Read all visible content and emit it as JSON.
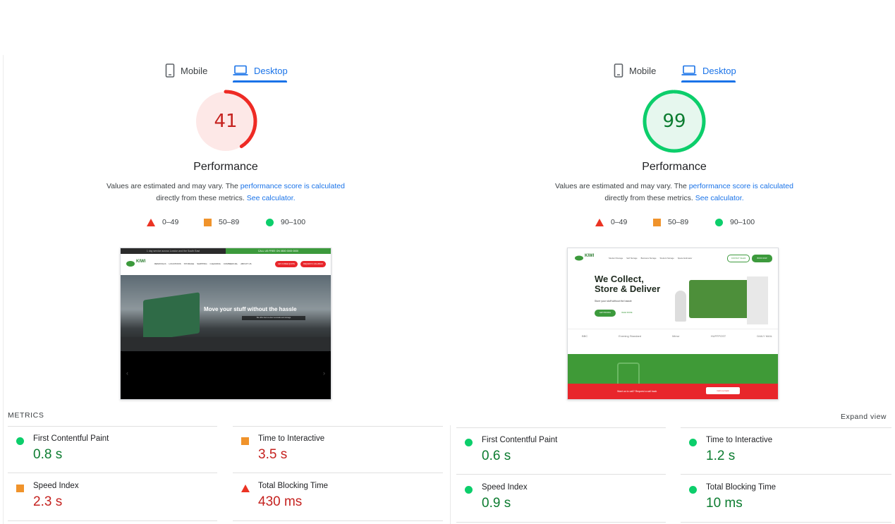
{
  "left": {
    "tabs": {
      "mobile": "Mobile",
      "desktop": "Desktop"
    },
    "score": "41",
    "score_fraction": 0.41,
    "score_color": "#ee2a24",
    "score_bg": "#fde8e7",
    "title": "Performance",
    "desc_prefix": "Values are estimated and may vary. The ",
    "desc_link1": "performance score is calculated",
    "desc_mid": " directly from these metrics. ",
    "desc_link2": "See calculator.",
    "legend": {
      "fail": "0–49",
      "average": "50–89",
      "pass": "90–100"
    },
    "thumbnail": {
      "topbar_left": "1 day service across London and the South East",
      "topbar_right": "CALL US FREE ON 0800 0000 0000",
      "logo": "KIWI",
      "nav": [
        "REMOVALS",
        "LOCATIONS",
        "STORAGE",
        "SHIPPING",
        "CLEANING",
        "COMMERCIAL",
        "ABOUT US"
      ],
      "btn1": "GET A FREE QUOTE",
      "btn2": "REQUEST A CALLBACK",
      "hero_text": "Move your stuff without the hassle",
      "hero_sub": "We offer door-to-door removals and storage"
    },
    "metrics_label": "METRICS",
    "metrics": [
      {
        "name": "First Contentful Paint",
        "value": "0.8 s",
        "rating": "pass"
      },
      {
        "name": "Time to Interactive",
        "value": "3.5 s",
        "rating": "average"
      },
      {
        "name": "Speed Index",
        "value": "2.3 s",
        "rating": "average"
      },
      {
        "name": "Total Blocking Time",
        "value": "430 ms",
        "rating": "fail"
      }
    ]
  },
  "right": {
    "tabs": {
      "mobile": "Mobile",
      "desktop": "Desktop"
    },
    "score": "99",
    "score_fraction": 0.99,
    "score_color": "#0cce6b",
    "score_bg": "#e6f7ee",
    "title": "Performance",
    "desc_prefix": "Values are estimated and may vary. The ",
    "desc_link1": "performance score is calculated",
    "desc_mid": " directly from these metrics. ",
    "desc_link2": "See calculator.",
    "legend": {
      "fail": "0–49",
      "average": "50–89",
      "pass": "90–100"
    },
    "thumbnail": {
      "logo": "KIWI",
      "nav": [
        "Student Storage",
        "Self Storage",
        "Business Storage",
        "Student Storage",
        "Space Estimator"
      ],
      "btn1": "CONTACT SALES",
      "btn2": "BOOK NOW",
      "headline1": "We Collect,",
      "headline2": "Store & Deliver",
      "sub": "Store your stuff without the hassle",
      "cta1": "GET PRICING",
      "cta2": "READ MORE",
      "press": [
        "BBC",
        "Evening Standard",
        "Mirror",
        "HUFFPOST",
        "DAILY MAIL"
      ],
      "banner_text": "Want us to call? Request a call back",
      "banner_btn": "Call me back"
    },
    "expand": "Expand view",
    "metrics": [
      {
        "name": "First Contentful Paint",
        "value": "0.6 s",
        "rating": "pass"
      },
      {
        "name": "Time to Interactive",
        "value": "1.2 s",
        "rating": "pass"
      },
      {
        "name": "Speed Index",
        "value": "0.9 s",
        "rating": "pass"
      },
      {
        "name": "Total Blocking Time",
        "value": "10 ms",
        "rating": "pass"
      }
    ]
  },
  "colors": {
    "fail": "#eb3323",
    "average": "#f0932b",
    "pass": "#0cce6b",
    "link": "#1a73e8"
  }
}
